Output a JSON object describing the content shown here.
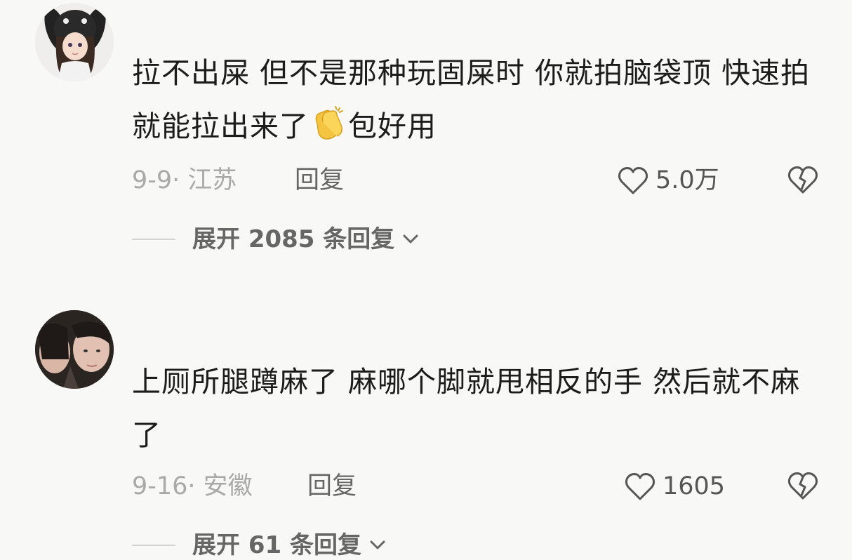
{
  "comments": [
    {
      "text_part1": "拉不出屎 但不是那种玩固屎时 你就拍脑袋顶 快速拍就能拉出来了",
      "emoji": "clapping-hands-icon",
      "text_part2": "包好用",
      "date_location": "9-9· 江苏",
      "reply_label": "回复",
      "likes": "5.0万",
      "expand_label": "展开 2085 条回复"
    },
    {
      "text_part1": "上厕所腿蹲麻了 麻哪个脚就甩相反的手 然后就不麻了",
      "text_part2": "",
      "date_location": "9-16· 安徽",
      "reply_label": "回复",
      "likes": "1605",
      "expand_label": "展开 61 条回复"
    }
  ],
  "colors": {
    "background": "#f8f8f6",
    "text": "#1c1c1c",
    "meta": "#a9a9a9",
    "action": "#666666",
    "emoji": "#f5c542"
  }
}
